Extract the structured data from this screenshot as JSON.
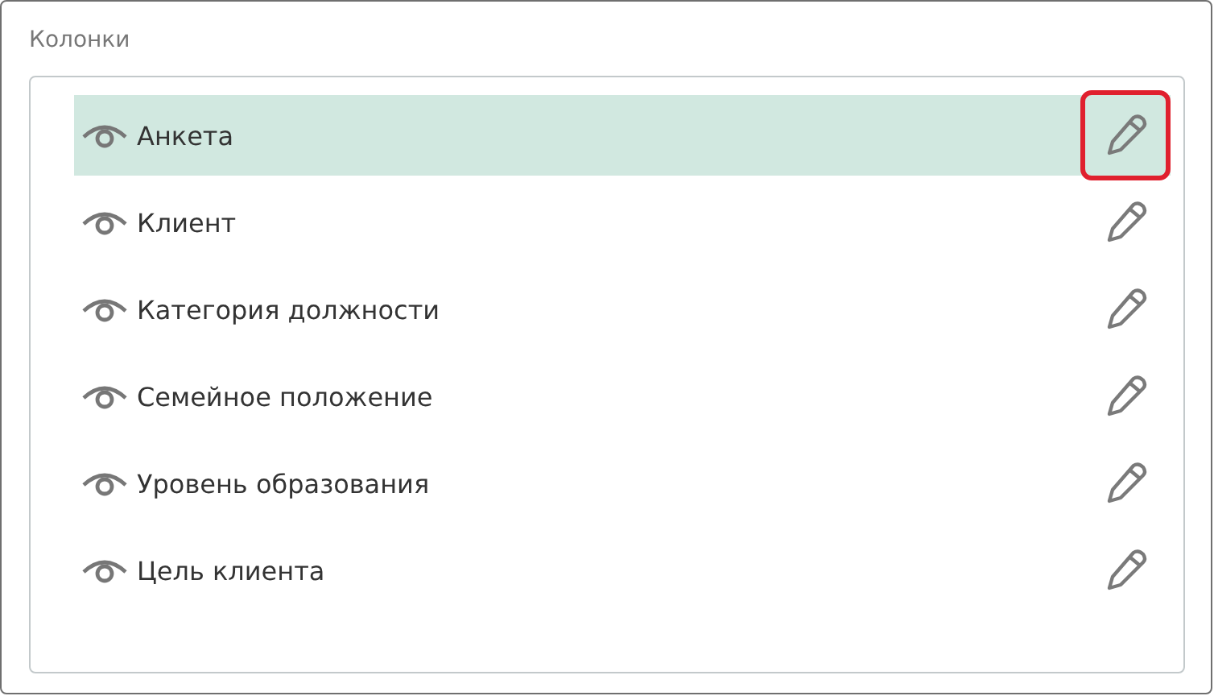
{
  "panel": {
    "title": "Колонки"
  },
  "columns": [
    {
      "label": "Анкета",
      "selected": true,
      "visible": true,
      "annotated": true
    },
    {
      "label": "Клиент",
      "selected": false,
      "visible": true,
      "annotated": false
    },
    {
      "label": "Категория должности",
      "selected": false,
      "visible": true,
      "annotated": false
    },
    {
      "label": "Семейное положение",
      "selected": false,
      "visible": true,
      "annotated": false
    },
    {
      "label": "Уровень образования",
      "selected": false,
      "visible": true,
      "annotated": false
    },
    {
      "label": "Цель клиента",
      "selected": false,
      "visible": true,
      "annotated": false
    }
  ]
}
